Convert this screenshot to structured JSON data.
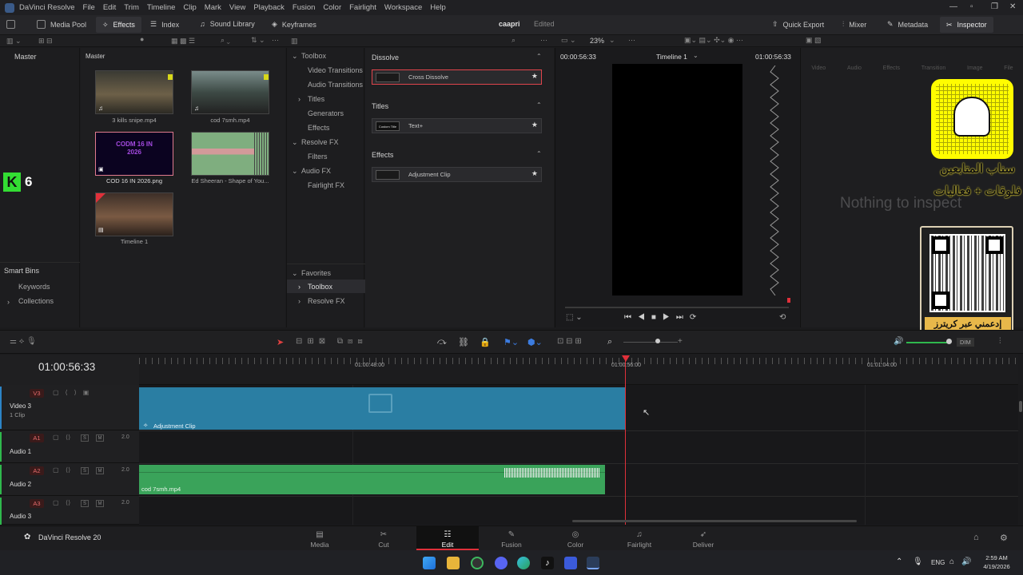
{
  "app": {
    "title": "DaVinci Resolve",
    "menu": [
      "File",
      "Edit",
      "Trim",
      "Timeline",
      "Clip",
      "Mark",
      "View",
      "Playback",
      "Fusion",
      "Color",
      "Fairlight",
      "Workspace",
      "Help"
    ],
    "project": "caapri",
    "project_status": "Edited",
    "brand": "DaVinci Resolve 20"
  },
  "toolbar": {
    "media_pool": "Media Pool",
    "effects": "Effects",
    "index": "Index",
    "sound_library": "Sound Library",
    "keyframes": "Keyframes",
    "quick_export": "Quick Export",
    "mixer": "Mixer",
    "metadata": "Metadata",
    "inspector": "Inspector",
    "zoom": "23%"
  },
  "bins": {
    "master": "Master",
    "smart_bins": "Smart Bins",
    "keywords": "Keywords",
    "collections": "Collections"
  },
  "media": {
    "header": "Master",
    "clips": [
      "3 kills snipe.mp4",
      "cod 7smh.mp4",
      "COD 16 IN 2026.png",
      "Ed Sheeran - Shape of You...",
      "Timeline 1"
    ],
    "cod_thumb_text": "CODM 16 IN 2026"
  },
  "effects_tree": {
    "toolbox": "Toolbox",
    "video_transitions": "Video Transitions",
    "audio_transitions": "Audio Transitions",
    "titles": "Titles",
    "generators": "Generators",
    "effects": "Effects",
    "resolve_fx": "Resolve FX",
    "filters": "Filters",
    "audio_fx": "Audio FX",
    "fairlight_fx": "Fairlight FX",
    "favorites": "Favorites",
    "fav_toolbox": "Toolbox",
    "fav_resolve_fx": "Resolve FX"
  },
  "effects_list": {
    "dissolve": "Dissolve",
    "cross_dissolve": "Cross Dissolve",
    "titles": "Titles",
    "text_plus": "Text+",
    "custom_title": "Custom Title",
    "effects": "Effects",
    "adjustment_clip": "Adjustment Clip"
  },
  "viewer": {
    "tc_left": "00:00:56:33",
    "timeline_name": "Timeline 1",
    "tc_right": "01:00:56:33"
  },
  "inspector": {
    "tabs": [
      "Video",
      "Audio",
      "Effects",
      "Transition",
      "Image",
      "File"
    ],
    "empty": "Nothing to inspect"
  },
  "overlay": {
    "snap_line1": "سناب المتابعين",
    "snap_line2": "فلوقات + فعاليات",
    "qr_caption": "إدعمني عبر كريترز",
    "badge": "6"
  },
  "timeline": {
    "timecode": "01:00:56:33",
    "ruler": [
      "01:00:48:00",
      "01:00:56:00",
      "01:01:04:00"
    ],
    "v3": "V3",
    "video3": "Video 3",
    "v3_clips": "1 Clip",
    "adj_clip": "Adjustment Clip",
    "a1": "A1",
    "audio1": "Audio 1",
    "a2": "A2",
    "audio2": "Audio 2",
    "a3": "A3",
    "audio3": "Audio 3",
    "vol": "2.0",
    "audio_clip": "cod 7smh.mp4",
    "dim": "DIM",
    "s": "S",
    "m": "M"
  },
  "pages": [
    "Media",
    "Cut",
    "Edit",
    "Fusion",
    "Color",
    "Fairlight",
    "Deliver"
  ],
  "taskbar": {
    "lang": "ENG",
    "time": "2:59 AM",
    "date": "4/19/2026"
  }
}
